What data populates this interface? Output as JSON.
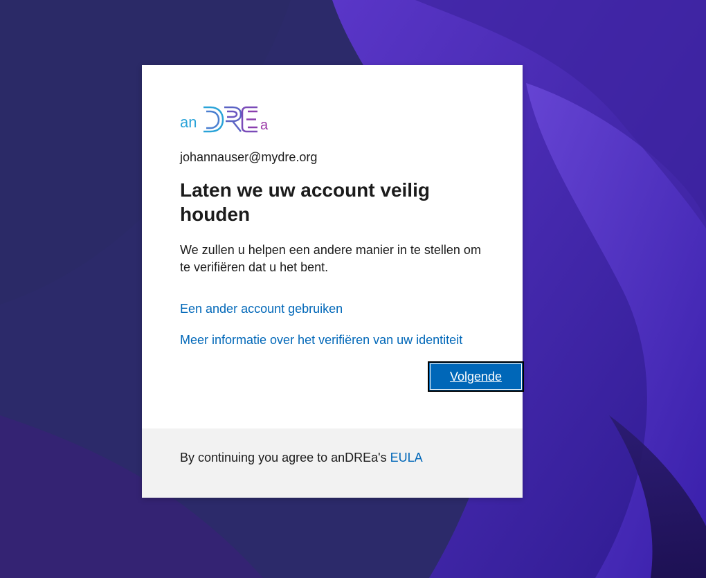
{
  "colors": {
    "link": "#0067b8",
    "button_bg": "#0067b8",
    "text": "#1b1b1b",
    "footer_bg": "#f2f2f2"
  },
  "logo": {
    "text": "anDREa",
    "icon": "andrea-logo"
  },
  "signin": {
    "identity": "johannauser@mydre.org",
    "title": "Laten we uw account veilig houden",
    "description": "We zullen u helpen een andere manier in te stellen om te verifiëren dat u het bent.",
    "link_other_account": "Een ander account gebruiken",
    "link_more_info": "Meer informatie over het verifiëren van uw identiteit",
    "next_button": "Volgende"
  },
  "footer": {
    "agree_text": "By continuing you agree to anDREa's ",
    "eula_link": "EULA"
  }
}
